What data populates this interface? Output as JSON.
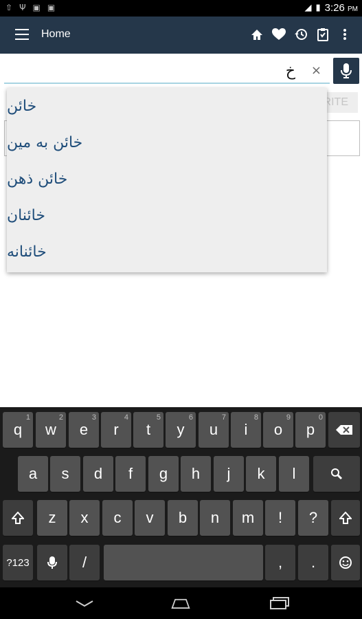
{
  "statusbar": {
    "time": "3:26",
    "ampm": "PM"
  },
  "appbar": {
    "title": "Home"
  },
  "search": {
    "value": "خ",
    "clear": "×"
  },
  "transliterate_label": "RITE",
  "suggestions": [
    "خائن",
    "خائن به مین",
    "خائن ذهن",
    "خائنان",
    "خائنانه"
  ],
  "keyboard": {
    "row1": [
      {
        "label": "q",
        "hint": "1"
      },
      {
        "label": "w",
        "hint": "2"
      },
      {
        "label": "e",
        "hint": "3"
      },
      {
        "label": "r",
        "hint": "4"
      },
      {
        "label": "t",
        "hint": "5"
      },
      {
        "label": "y",
        "hint": "6"
      },
      {
        "label": "u",
        "hint": "7"
      },
      {
        "label": "i",
        "hint": "8"
      },
      {
        "label": "o",
        "hint": "9"
      },
      {
        "label": "p",
        "hint": "0"
      }
    ],
    "row2": [
      "a",
      "s",
      "d",
      "f",
      "g",
      "h",
      "j",
      "k",
      "l"
    ],
    "row3": [
      "z",
      "x",
      "c",
      "v",
      "b",
      "n",
      "m",
      "!",
      "?"
    ],
    "symbols_label": "?123",
    "slash": "/",
    "comma": ",",
    "period": "."
  },
  "colors": {
    "appbar": "#25374a",
    "suggestion_text": "#1f4d7a"
  }
}
